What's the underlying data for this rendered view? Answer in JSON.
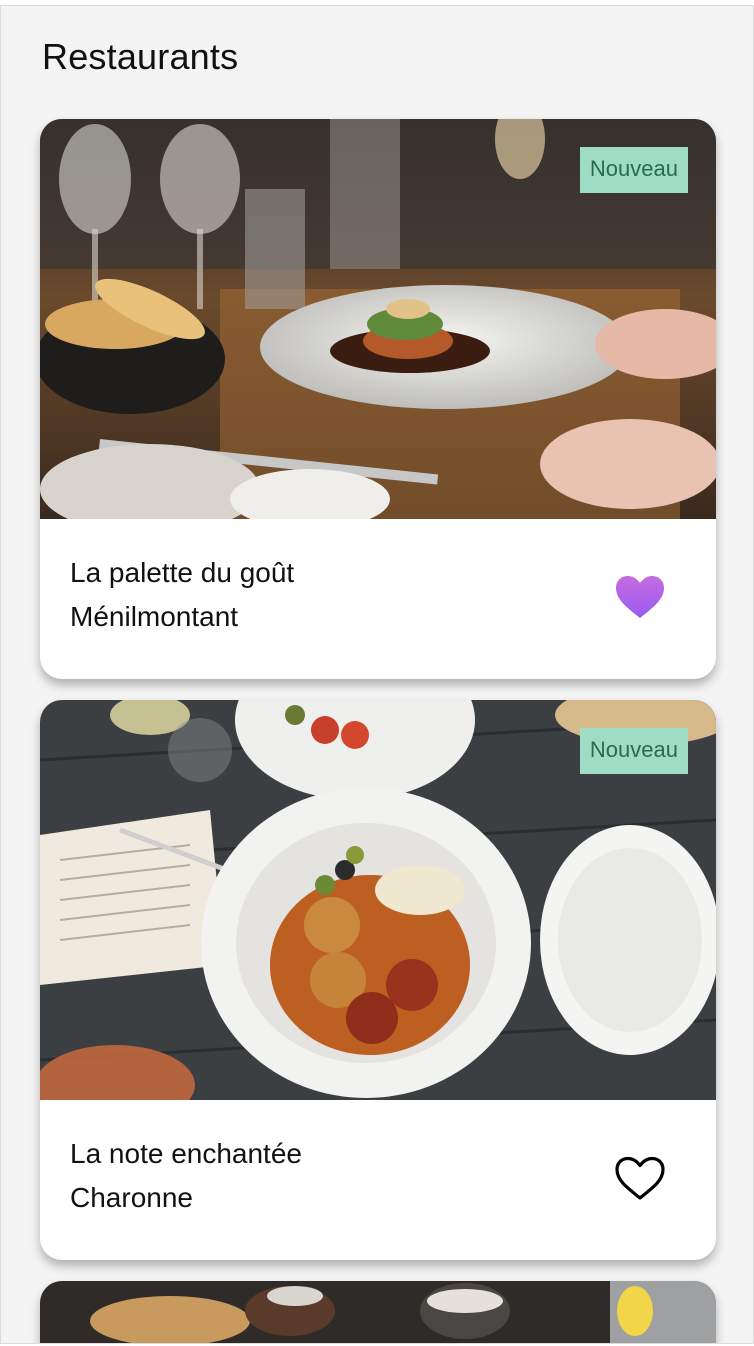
{
  "header": {
    "title": "Restaurants"
  },
  "restaurants": [
    {
      "name": "La palette du goût",
      "district": "Ménilmontant",
      "badge": "Nouveau",
      "favorite": true,
      "photo": "plated-dish-table-photo"
    },
    {
      "name": "La note enchantée",
      "district": "Charonne",
      "badge": "Nouveau",
      "favorite": false,
      "photo": "overhead-meatballs-plate-photo"
    },
    {
      "photo": "table-bread-cups-photo"
    }
  ],
  "colors": {
    "page_bg": "#f4f4f4",
    "badge_bg": "#9fdcc5",
    "badge_text": "#2a6a52",
    "heart_gradient_top": "#c56be0",
    "heart_gradient_bottom": "#9a5cf0"
  },
  "icons": {
    "favorite_filled": "heart-filled-icon",
    "favorite_outline": "heart-outline-icon"
  }
}
